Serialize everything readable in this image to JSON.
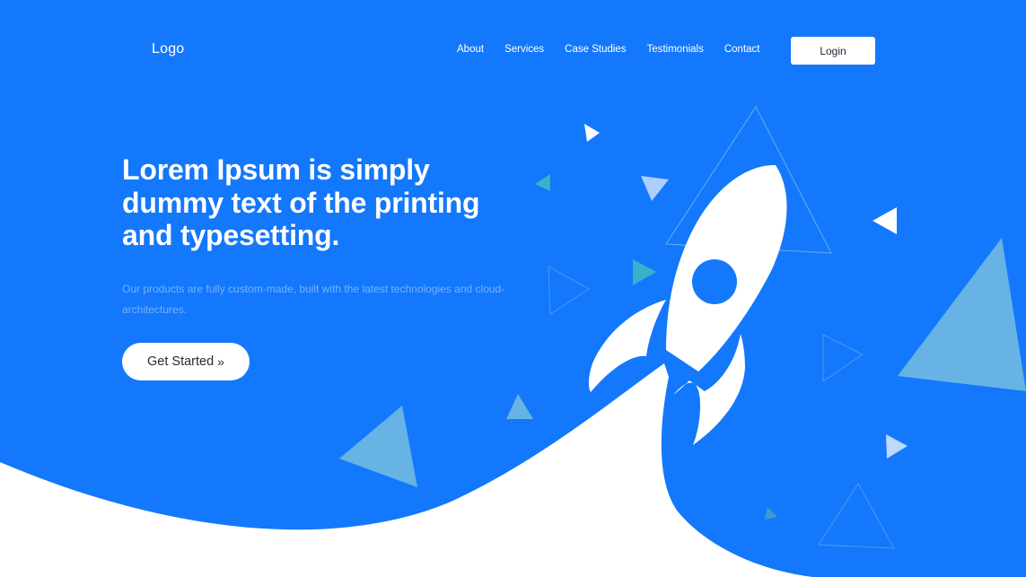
{
  "brand": {
    "logo_text": "Logo"
  },
  "nav": {
    "items": [
      {
        "label": "About"
      },
      {
        "label": "Services"
      },
      {
        "label": "Case Studies"
      },
      {
        "label": "Testimonials"
      },
      {
        "label": "Contact"
      }
    ],
    "login_label": "Login"
  },
  "hero": {
    "title": "Lorem Ipsum is simply dummy text of the printing and typesetting.",
    "subtitle": "Our products are fully custom-made, built with the latest technologies and cloud-architectures.",
    "cta_label": "Get Started",
    "cta_icon": "»"
  },
  "colors": {
    "primary_blue": "#1378FB",
    "light_blue": "#67B3E5",
    "white": "#FFFFFF"
  },
  "illustration": {
    "icon": "rocket-icon"
  }
}
